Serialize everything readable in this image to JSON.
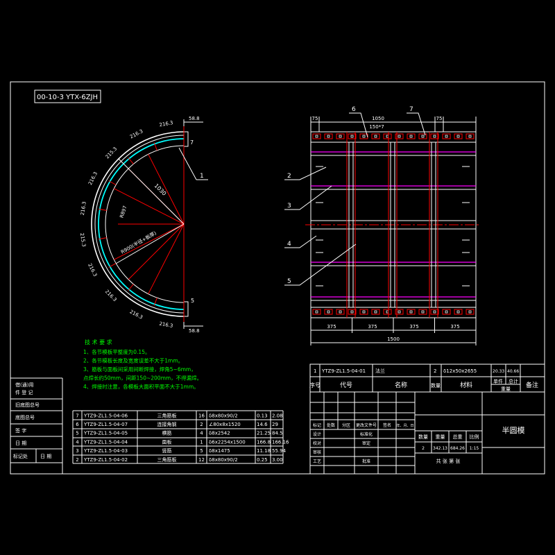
{
  "colors": {
    "background": "#000000",
    "line": "#ffffff",
    "center_line": "#ff0000",
    "rib_line": "#ff00ff",
    "face_arc": "#00ffff",
    "notes": "#00ff00"
  },
  "drawing_code": "00-10-3 YTX-6ZJH",
  "side_strip": {
    "rows": [
      "借(通)用",
      "件 登 记",
      "旧底图总号",
      "底图总号",
      "签  字",
      "日  期"
    ],
    "bottom_left": "标记处",
    "bottom_right": "日 期"
  },
  "semicircle": {
    "top_flange": "58.8",
    "bottom_flange": "58.8",
    "callout_top": "7",
    "callout_main": "1",
    "callout_bottom": "5",
    "radius_dim": "1030",
    "inner_radius": "R897",
    "outer_radius": "R900(半径+板厚)",
    "arc_segments": [
      "216.3",
      "216.3",
      "215.3",
      "216.3",
      "216.3",
      "215.3",
      "216.3",
      "216.3",
      "216.3",
      "216.3"
    ]
  },
  "plate": {
    "top_dims": {
      "left": "75",
      "middle": "1050",
      "pitch": "150*7",
      "right": "75"
    },
    "callout_6": "6",
    "callout_7": "7",
    "callouts_left": [
      "2",
      "3",
      "4",
      "5"
    ],
    "bottom_dims": [
      "375",
      "375",
      "375",
      "375"
    ],
    "overall": "1500"
  },
  "notes": {
    "title": "技 术 要 求",
    "lines": [
      "1、各节模板平整度为0.15。",
      "2、各节模板长度及宽度误差不大于1mm。",
      "3、筋板与面板间采用间断焊接，焊角5~6mm，",
      "   点焊长约50mm，间距150~200mm，不得漏焊。",
      "4、焊接时注意，各模板大面积平面不大于1mm。"
    ]
  },
  "parts": {
    "rows": [
      {
        "no": "7",
        "code": "YTZ9-ZL1.5-04-06",
        "name": "三角筋板",
        "qty": "16",
        "material": "δ8x80x90/2",
        "unit_weight": "0.13",
        "total_weight": "2.08"
      },
      {
        "no": "6",
        "code": "YTZ9-ZL1.5-04-07",
        "name": "连接角钢",
        "qty": "2",
        "material": "∠80x8x1520",
        "unit_weight": "14.6",
        "total_weight": "29"
      },
      {
        "no": "5",
        "code": "YTZ9-ZL1.5-04-05",
        "name": "横筋",
        "qty": "4",
        "material": "δ8x2542",
        "unit_weight": "21.25",
        "total_weight": "84.5"
      },
      {
        "no": "4",
        "code": "YTZ9-ZL1.5-04-04",
        "name": "面板",
        "qty": "1",
        "material": "δ6x2254x1500",
        "unit_weight": "166.8",
        "total_weight": "166.16"
      },
      {
        "no": "3",
        "code": "YTZ9-ZL1.5-04-03",
        "name": "竖筋",
        "qty": "5",
        "material": "δ8x1475",
        "unit_weight": "11.18",
        "total_weight": "55.94"
      },
      {
        "no": "2",
        "code": "YTZ9-ZL1.5-04-02",
        "name": "三角筋板",
        "qty": "12",
        "material": "δ8x80x90/2",
        "unit_weight": "0.25",
        "total_weight": "3.00"
      }
    ]
  },
  "title_block": {
    "row1": {
      "no": "1",
      "code": "YTZ9-ZL1.5-04-01",
      "name": "法兰",
      "qty": "2",
      "material": "δ12x50x2655",
      "unit_weight": "20.33",
      "total_weight": "40.66"
    },
    "header": {
      "no": "序号",
      "code": "代号",
      "name": "名称",
      "qty": "数量",
      "material": "材料",
      "single": "单件",
      "total": "总计",
      "weight": "重量",
      "remark": "备注"
    },
    "change_header": [
      "标记",
      "处数",
      "分区",
      "更改文件号",
      "签名",
      "年、月、日"
    ],
    "signoff_left": [
      "设计",
      "校对",
      "审核",
      "工艺"
    ],
    "signoff_right": [
      "标准化",
      "审定",
      "",
      "批准"
    ],
    "stage_headers": [
      "数量",
      "重量",
      "总重",
      "比例"
    ],
    "stage_values": [
      "2",
      "342.13",
      "684.26",
      "1:15"
    ],
    "sheet_count": "共 张 第 张",
    "drawing_name": "半圆模"
  }
}
